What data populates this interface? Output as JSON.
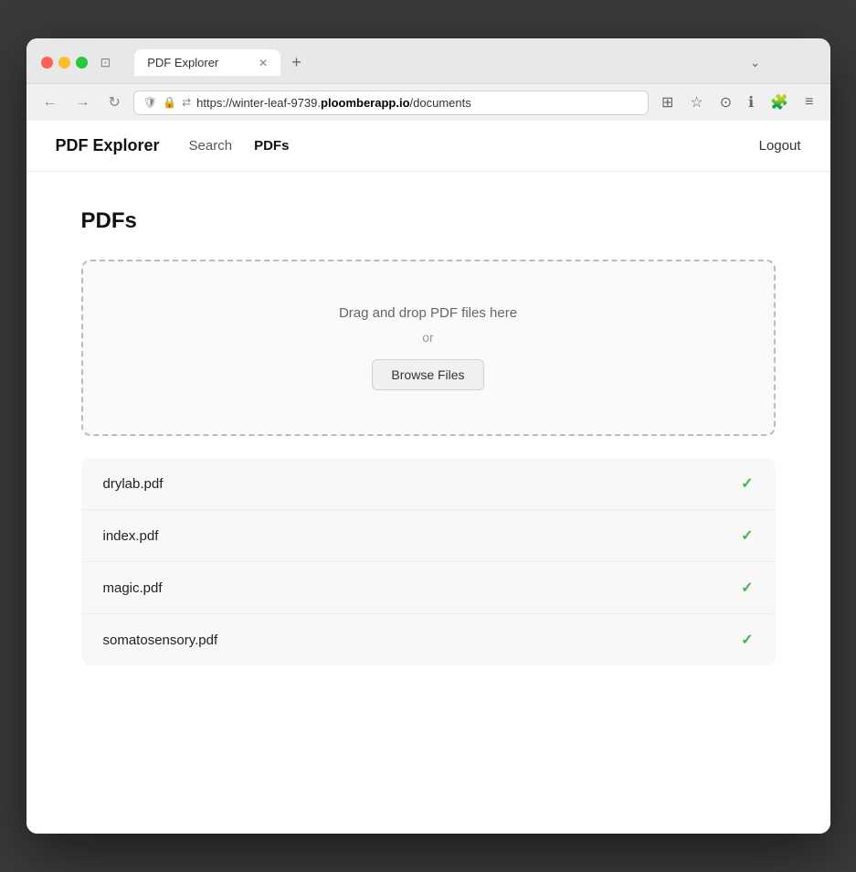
{
  "browser": {
    "tab_title": "PDF Explorer",
    "url": "https://winter-leaf-9739.ploomberapp.io/documents",
    "url_domain": "ploomberapp.io",
    "url_path": "/documents",
    "url_subdomain": "winter-leaf-9739.",
    "new_tab_label": "+",
    "chevron": "⌄"
  },
  "nav_buttons": {
    "back": "←",
    "forward": "→",
    "reload": "↻"
  },
  "nav_actions": {
    "shield": "🛡",
    "lock": "🔒",
    "extensions": "🧩",
    "menu": "≡",
    "bookmark": "☆",
    "pocket": "💾",
    "account": "ℹ"
  },
  "app": {
    "logo": "PDF Explorer",
    "nav_links": [
      {
        "label": "Search",
        "active": false
      },
      {
        "label": "PDFs",
        "active": true
      }
    ],
    "logout_label": "Logout"
  },
  "page": {
    "title": "PDFs",
    "drop_zone": {
      "drag_text": "Drag and drop PDF files here",
      "or_text": "or",
      "browse_label": "Browse Files"
    },
    "files": [
      {
        "name": "drylab.pdf",
        "uploaded": true
      },
      {
        "name": "index.pdf",
        "uploaded": true
      },
      {
        "name": "magic.pdf",
        "uploaded": true
      },
      {
        "name": "somatosensory.pdf",
        "uploaded": true
      }
    ]
  }
}
